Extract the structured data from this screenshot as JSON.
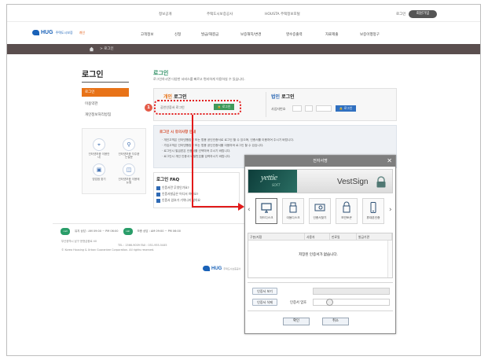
{
  "utility": {
    "links": [
      "정보공개",
      "주택도시보증공사",
      "HOUSTA 주택정보포털"
    ],
    "login": "로그인",
    "join": "회원가입"
  },
  "gnb": {
    "logo": "HUG",
    "logo_sub": "주택도시보증",
    "logo_tag": "개인",
    "items": [
      "고객정보",
      "신청",
      "발급/해결금",
      "보증해지/변경",
      "영수증출력",
      "자료제출",
      "보증이행청구"
    ]
  },
  "location": {
    "current": "> 로그인"
  },
  "lnb": {
    "title": "로그인",
    "items": [
      "로그인",
      "이용약관",
      "개인정보처리방침"
    ],
    "quick": [
      "인터넷보증 이용안내",
      "인터넷보증 자주묻는질문",
      "영업점 찾기",
      "인터넷보증 이용매뉴얼"
    ]
  },
  "main": {
    "title": "로그인",
    "desc": "로그인하시면 다양한 서비스를 빠르고 편리하게 이용하실 수 있습니다.",
    "personal": {
      "title_hl": "개인",
      "title": " 로그인",
      "label": "공인인증서 로그인",
      "button": "로그인"
    },
    "corporate": {
      "title_hl": "법인",
      "title": " 로그인",
      "label": "사업자번호",
      "button": "로그인"
    },
    "notice": {
      "title": "로그인 시 유의사항 안내",
      "lines": [
        "· 개인고객은 인터넷뱅킹용 또는 범용 공인인증서로 로그인 할 수 있으며, 인증서를 이용하여 주시기 바랍니다.",
        "· 가입고객은 인터넷뱅킹용 또는 범용 공인인증서를 이용하여 로그인 할 수 있습니다.",
        "· 로그인시 발급받은 인증서를 선택하여 주시기 바랍니다.",
        "· 로그인시 개인 인증서 비밀번호를 입력하시기 바랍니다."
      ]
    },
    "faq": {
      "title": "로그인 FAQ",
      "items": [
        "인증서란 무엇인가요?",
        "인증서발급은 어디서 하나요?",
        "인증서 암호가 기억나지 않아요"
      ]
    }
  },
  "footer": {
    "calls": [
      {
        "badge": "call",
        "text": "유지 상담 : AM 09:00 ~ PM 06:00"
      },
      {
        "badge": "call",
        "text": "보증 상담 : AM 09:00 ~ PM 06:00"
      }
    ],
    "lines": [
      "부산광역시 남구 문현금융로 40",
      "TEL : 1566-9009  FAX : 051-955-5445",
      "© Korea Housing & Urban Guarantee Corporation. All rights reserved."
    ],
    "logo": "HUG",
    "logo_sub": "주택도시보증공사"
  },
  "cert": {
    "title": "전자서명",
    "brand_left": "yettie",
    "brand_soft": "SOFT",
    "brand_right": "VestSign",
    "locations": [
      "하드디스크",
      "이동디스크",
      "인증서찾기",
      "보안토큰",
      "휴대폰인증"
    ],
    "columns": [
      "구분/지정",
      "사용자",
      "만료일",
      "발급기관"
    ],
    "empty": "저장된 인증서가 없습니다.",
    "view_button": "인증서 보기",
    "delete_button": "인증서 삭제",
    "password_label": "인증서 암호",
    "ok": "확인",
    "cancel": "취소"
  },
  "annotation": {
    "step": "1"
  },
  "colors": {
    "accent_orange": "#e87318",
    "hug_blue": "#1a62b8",
    "location_bar": "#5a4e4e",
    "highlight_red": "#e21a1a"
  }
}
